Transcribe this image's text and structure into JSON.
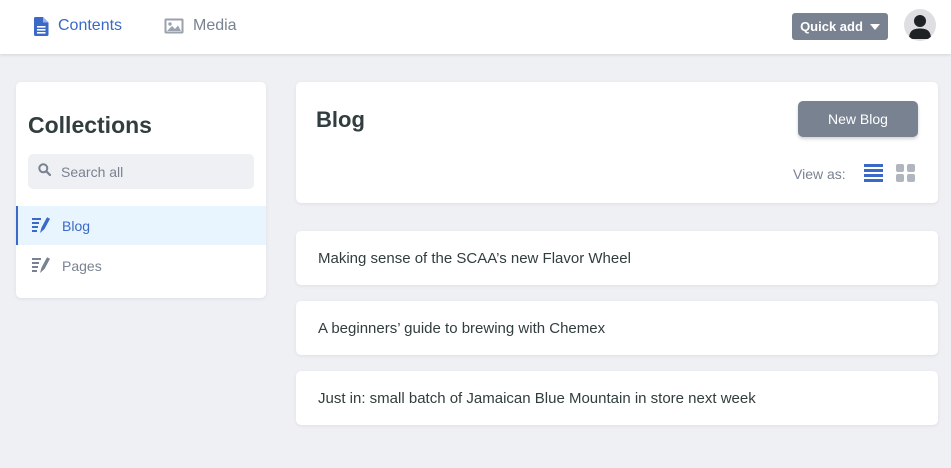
{
  "nav": {
    "contents_label": "Contents",
    "media_label": "Media",
    "quick_add_label": "Quick add",
    "active_color": "#3a69c7",
    "inactive_color": "#798291"
  },
  "sidebar": {
    "title": "Collections",
    "search_placeholder": "Search all",
    "items": [
      {
        "label": "Blog",
        "icon": "edit-list-icon",
        "active": true
      },
      {
        "label": "Pages",
        "icon": "edit-list-icon",
        "active": false
      }
    ]
  },
  "main": {
    "title": "Blog",
    "new_button_label": "New Blog",
    "view_as_label": "View as:",
    "view_mode": "list",
    "entries": [
      "Making sense of the SCAA’s new Flavor Wheel",
      "A beginners’ guide to brewing with Chemex",
      "Just in: small batch of Jamaican Blue Mountain in store next week"
    ]
  }
}
